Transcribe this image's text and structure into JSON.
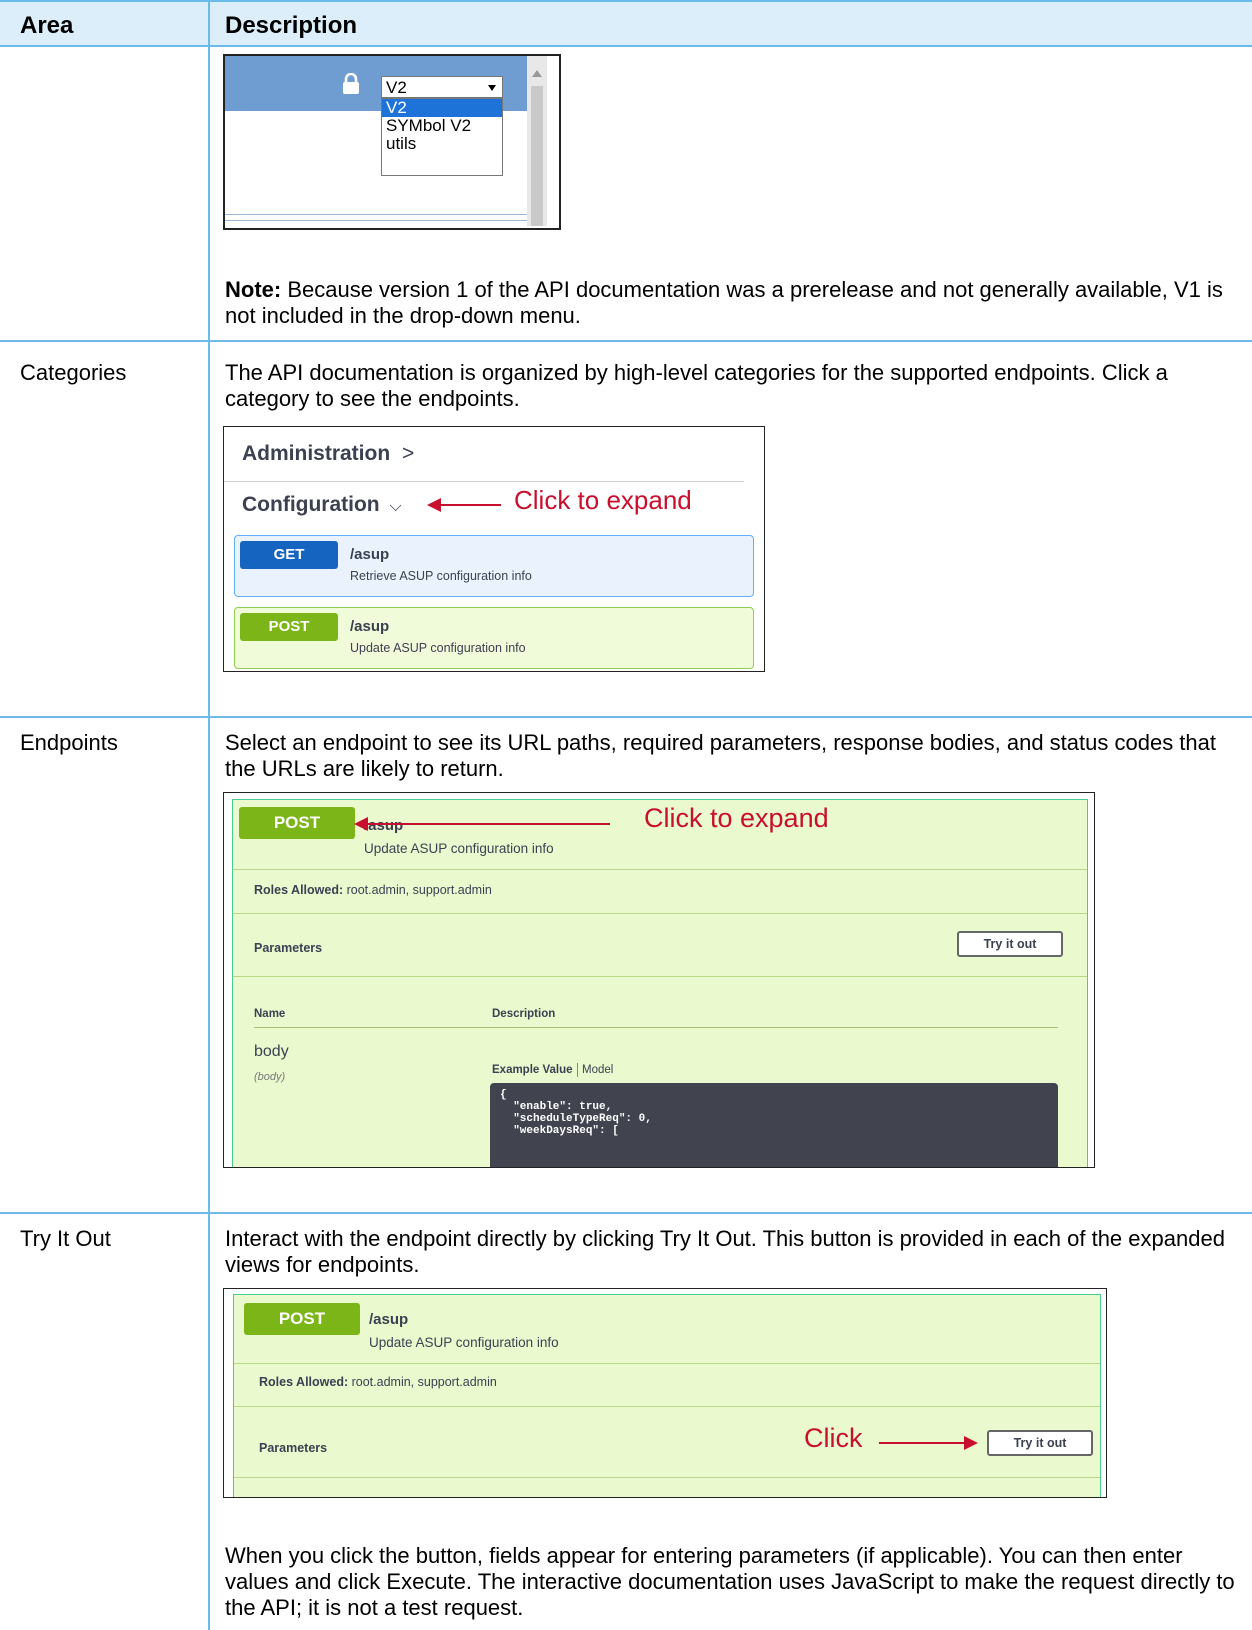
{
  "header": {
    "col1": "Area",
    "col2": "Description"
  },
  "version_dropdown": {
    "selected": "V2",
    "options": [
      "V2",
      "SYMbol V2",
      "utils"
    ]
  },
  "note": {
    "label": "Note:",
    "text": " Because version 1 of the API documentation was a prerelease and not generally available, V1 is not included in the drop-down menu."
  },
  "rows": {
    "categories": {
      "area": "Categories",
      "text": "The API documentation is organized by high-level categories for the supported endpoints. Click a category to see the endpoints."
    },
    "endpoints": {
      "area": "Endpoints",
      "text": "Select an endpoint to see its URL paths, required parameters, response bodies, and status codes that the URLs are likely to return."
    },
    "try_it_out": {
      "area": "Try It Out",
      "text": "Interact with the endpoint directly by clicking Try It Out. This button is provided in each of the expanded views for endpoints.",
      "text2": "When you click the button, fields appear for entering parameters (if applicable). You can then enter values and click Execute. The interactive documentation uses JavaScript to make the request directly to the API; it is not a test request."
    }
  },
  "categories_shot": {
    "cat1": "Administration",
    "cat1_chevron": ">",
    "cat2": "Configuration",
    "cat2_chevron": "⌵",
    "annotation": "Click to expand",
    "get": {
      "method": "GET",
      "path": "/asup",
      "summary": "Retrieve ASUP configuration info"
    },
    "post": {
      "method": "POST",
      "path": "/asup",
      "summary": "Update ASUP configuration info"
    }
  },
  "endpoint_shot": {
    "method": "POST",
    "path": "/asup",
    "summary": "Update ASUP configuration info",
    "annotation": "Click to expand",
    "roles_label": "Roles Allowed:",
    "roles_value": " root.admin, support.admin",
    "parameters": "Parameters",
    "try_button": "Try it out",
    "col_name": "Name",
    "col_desc": "Description",
    "param_name": "body",
    "param_in": "(body)",
    "example_value": "Example Value",
    "model": "Model",
    "code": "{\n  \"enable\": true,\n  \"scheduleTypeReq\": 0,\n  \"weekDaysReq\": ["
  },
  "tryout_shot": {
    "method": "POST",
    "path": "/asup",
    "summary": "Update ASUP configuration info",
    "roles_label": "Roles Allowed:",
    "roles_value": " root.admin, support.admin",
    "parameters": "Parameters",
    "annotation": "Click",
    "try_button": "Try it out"
  },
  "colors": {
    "border": "#6bbbe8",
    "header_bg": "#dbeefa",
    "get": "#1565c0",
    "post": "#7cb518",
    "annotation": "#c8102e"
  },
  "icons": {
    "lock": "lock-icon"
  }
}
